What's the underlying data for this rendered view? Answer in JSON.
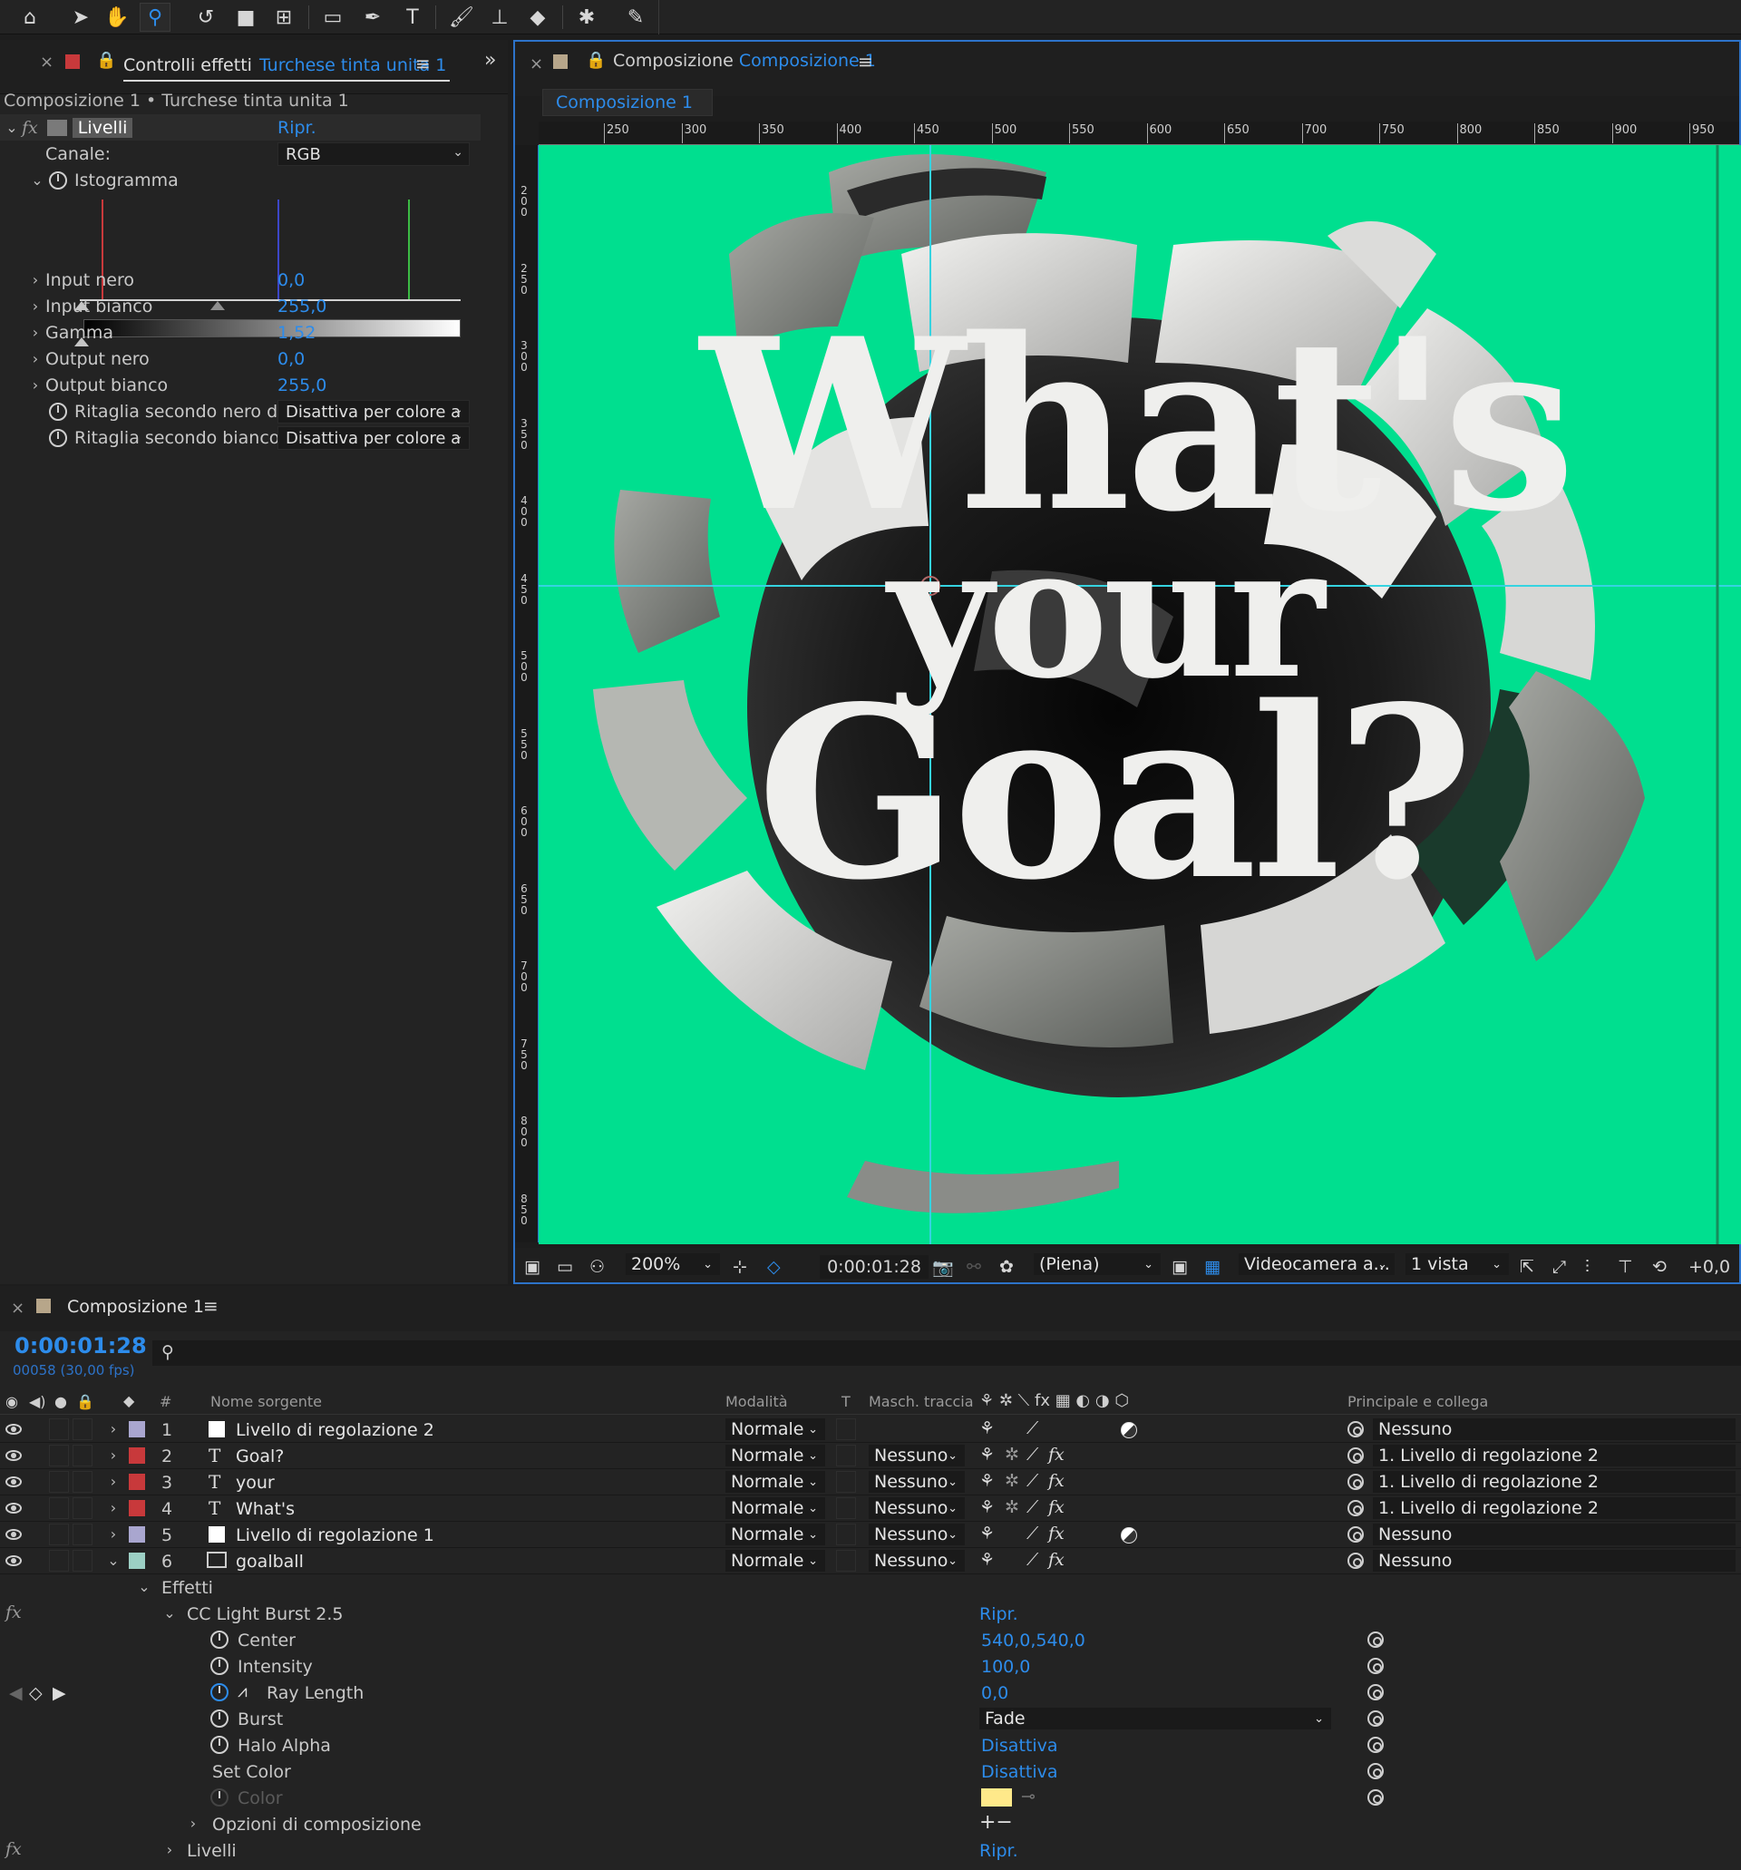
{
  "toolbar": {
    "tools": [
      "home-icon",
      "select-arrow-icon",
      "hand-icon",
      "zoom-icon",
      "rotate-icon",
      "camera-icon",
      "pan-behind-icon",
      "rectangle-icon",
      "pen-icon",
      "type-icon",
      "brush-icon",
      "clone-stamp-icon",
      "eraser-icon",
      "roto-brush-icon",
      "puppet-pin-icon"
    ]
  },
  "effects_panel": {
    "tab_prefix": "Controlli effetti",
    "tab_layer": "Turchese tinta unita 1",
    "breadcrumb": "Composizione 1 • Turchese tinta unita 1",
    "effect_name": "Livelli",
    "reset": "Ripr.",
    "channel_label": "Canale:",
    "channel_value": "RGB",
    "histogram_label": "Istogramma",
    "params": [
      {
        "label": "Input nero",
        "value": "0,0"
      },
      {
        "label": "Input bianco",
        "value": "255,0"
      },
      {
        "label": "Gamma",
        "value": "1,52"
      },
      {
        "label": "Output nero",
        "value": "0,0"
      },
      {
        "label": "Output bianco",
        "value": "255,0"
      }
    ],
    "clip_black_label": "Ritaglia secondo nero di o",
    "clip_black_value": "Disattiva per colore a",
    "clip_white_label": "Ritaglia secondo bianco d",
    "clip_white_value": "Disattiva per colore a"
  },
  "comp_panel": {
    "tab_prefix": "Composizione",
    "tab_name": "Composizione 1",
    "sub_tab": "Composizione 1",
    "ruler_ticks": [
      "250",
      "300",
      "350",
      "400",
      "450",
      "500",
      "550",
      "600",
      "650",
      "700",
      "750",
      "800",
      "850",
      "900",
      "950"
    ],
    "vruler_ticks": [
      "2 0 0",
      "2 5 0",
      "3 0 0",
      "3 5 0",
      "4 0 0",
      "4 5 0",
      "5 0 0",
      "5 5 0",
      "6 0 0",
      "6 5 0",
      "7 0 0",
      "7 5 0",
      "8 0 0",
      "8 5 0"
    ],
    "headline_lines": [
      "What's",
      "your",
      "Goal?"
    ],
    "canvas_color": "#00df8f",
    "zoom": "200%",
    "timecode": "0:00:01:28",
    "resolution": "(Piena)",
    "camera": "Videocamera a...",
    "views": "1 vista",
    "exposure": "+0,0"
  },
  "timeline": {
    "tab": "Composizione 1",
    "timecode": "0:00:01:28",
    "frame_info": "00058 (30,00 fps)",
    "columns": {
      "num": "#",
      "source": "Nome sorgente",
      "mode": "Modalità",
      "t": "T",
      "matte": "Masch. traccia",
      "parent": "Principale e collega"
    },
    "layers": [
      {
        "num": "1",
        "name": "Livello di regolazione 2",
        "color": "#a9a6cf",
        "type": "solid",
        "mode": "Normale",
        "matte": "",
        "parent": "Nessuno"
      },
      {
        "num": "2",
        "name": "Goal?",
        "color": "#c8393b",
        "type": "text",
        "mode": "Normale",
        "matte": "Nessuno",
        "parent": "1. Livello di regolazione 2"
      },
      {
        "num": "3",
        "name": "your",
        "color": "#c8393b",
        "type": "text",
        "mode": "Normale",
        "matte": "Nessuno",
        "parent": "1. Livello di regolazione 2"
      },
      {
        "num": "4",
        "name": "What's",
        "color": "#c8393b",
        "type": "text",
        "mode": "Normale",
        "matte": "Nessuno",
        "parent": "1. Livello di regolazione 2"
      },
      {
        "num": "5",
        "name": "Livello di regolazione 1",
        "color": "#a9a6cf",
        "type": "solid",
        "mode": "Normale",
        "matte": "Nessuno",
        "parent": "Nessuno"
      },
      {
        "num": "6",
        "name": "goalball",
        "color": "#9ccfc4",
        "type": "comp",
        "mode": "Normale",
        "matte": "Nessuno",
        "parent": "Nessuno"
      }
    ],
    "effects_group": "Effetti",
    "effect_name": "CC Light Burst 2.5",
    "effect_reset": "Ripr.",
    "effect_props": [
      {
        "label": "Center",
        "value": "540,0,540,0"
      },
      {
        "label": "Intensity",
        "value": "100,0"
      },
      {
        "label": "Ray Length",
        "value": "0,0"
      },
      {
        "label": "Burst",
        "value": "Fade"
      },
      {
        "label": "Halo Alpha",
        "value": "Disattiva"
      },
      {
        "label": "Set Color",
        "value": "Disattiva"
      },
      {
        "label": "Color",
        "value": ""
      }
    ],
    "color_swatch": "#ffe98a",
    "comp_options": "Opzioni di composizione",
    "levels_effect": "Livelli",
    "levels_reset": "Ripr."
  }
}
